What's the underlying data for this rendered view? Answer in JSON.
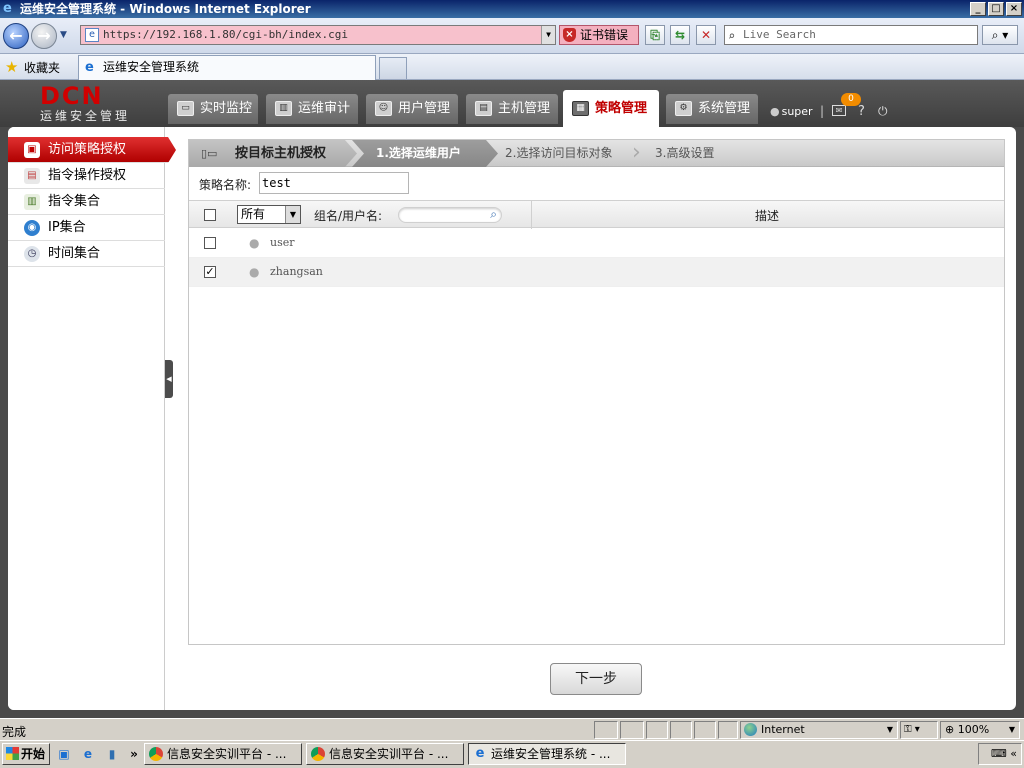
{
  "window": {
    "title": "运维安全管理系统 - Windows Internet Explorer",
    "controls": {
      "minimize": "_",
      "maximize": "□",
      "close": "×"
    }
  },
  "browser": {
    "back_icon": "back-arrow-icon",
    "forward_icon": "forward-arrow-icon",
    "address": "https://192.168.1.80/cgi-bh/index.cgi",
    "cert_error": "证书错误",
    "search_placeholder": "Live Search",
    "favorites_label": "收藏夹",
    "tab_title": "运维安全管理系统",
    "status_text": "完成",
    "zone": "Internet",
    "zoom": "100%"
  },
  "app": {
    "logo": "DCN",
    "logo_subtitle": "运维安全管理",
    "nav": [
      {
        "label": "实时监控",
        "icon": "monitor-icon"
      },
      {
        "label": "运维审计",
        "icon": "audit-icon"
      },
      {
        "label": "用户管理",
        "icon": "user-manage-icon"
      },
      {
        "label": "主机管理",
        "icon": "host-icon"
      },
      {
        "label": "策略管理",
        "icon": "policy-icon",
        "active": true
      },
      {
        "label": "系统管理",
        "icon": "gear-icon"
      }
    ],
    "user": "super",
    "mail_count": "0",
    "accent_color": "#c00000"
  },
  "sidebar": {
    "items": [
      {
        "label": "访问策略授权",
        "icon": "access-policy-icon",
        "active": true
      },
      {
        "label": "指令操作授权",
        "icon": "command-auth-icon"
      },
      {
        "label": "指令集合",
        "icon": "command-set-icon"
      },
      {
        "label": "IP集合",
        "icon": "ip-set-icon"
      },
      {
        "label": "时间集合",
        "icon": "clock-icon"
      }
    ]
  },
  "wizard": {
    "steps": [
      {
        "label": "按目标主机授权"
      },
      {
        "label": "1.选择运维用户",
        "current": true
      },
      {
        "label": "2.选择访问目标对象"
      },
      {
        "label": "3.高级设置"
      }
    ],
    "policy_name_label": "策略名称:",
    "policy_name_value": "test",
    "filter_select": "所有",
    "group_user_label": "组名/用户名:",
    "description_header": "描述",
    "rows": [
      {
        "name": "user",
        "checked": false
      },
      {
        "name": "zhangsan",
        "checked": true
      }
    ],
    "next_button": "下一步"
  },
  "taskbar": {
    "start": "开始",
    "tasks": [
      {
        "label": "信息安全实训平台 - ...",
        "icon": "chrome-icon"
      },
      {
        "label": "信息安全实训平台 - ...",
        "icon": "chrome-icon"
      },
      {
        "label": "运维安全管理系统 - ...",
        "icon": "ie-icon",
        "active": true
      }
    ]
  }
}
